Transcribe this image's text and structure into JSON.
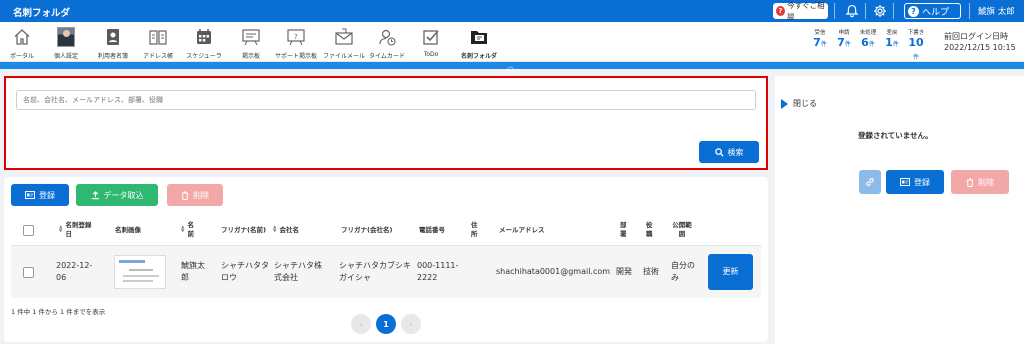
{
  "topbar": {
    "title": "名刺フォルダ",
    "consult_label": "今すぐご相談",
    "help_label": "ヘルプ",
    "user_name": "鯱旗 太郎"
  },
  "nav": {
    "items": [
      {
        "label": "ポータル",
        "icon": "home-icon"
      },
      {
        "label": "個人設定",
        "icon": "avatar"
      },
      {
        "label": "利用者名簿",
        "icon": "id-card-icon"
      },
      {
        "label": "アドレス帳",
        "icon": "address-book-icon"
      },
      {
        "label": "スケジューラ",
        "icon": "calendar-icon"
      },
      {
        "label": "掲示板",
        "icon": "board-icon"
      },
      {
        "label": "サポート掲示板",
        "icon": "support-board-icon"
      },
      {
        "label": "ファイルメール",
        "icon": "file-mail-icon"
      },
      {
        "label": "タイムカード",
        "icon": "timecard-icon"
      },
      {
        "label": "ToDo",
        "icon": "check-icon"
      },
      {
        "label": "名刺フォルダ",
        "icon": "card-folder-icon"
      }
    ]
  },
  "stats": [
    {
      "label": "受信",
      "value": "7",
      "unit": "件"
    },
    {
      "label": "申請",
      "value": "7",
      "unit": "件"
    },
    {
      "label": "未処理",
      "value": "6",
      "unit": "件"
    },
    {
      "label": "差戻",
      "value": "1",
      "unit": "件"
    },
    {
      "label": "下書き",
      "value": "10",
      "unit": "件"
    }
  ],
  "last_login": {
    "label": "前回ログイン日時",
    "value": "2022/12/15 10:15"
  },
  "search": {
    "placeholder": "名前、会社名、メールアドレス、部署、役職",
    "button_label": "検索"
  },
  "toolbar": {
    "register_label": "登録",
    "import_label": "データ取込",
    "delete_label": "削除"
  },
  "table": {
    "columns": {
      "reg_date": "名刺登録日",
      "image": "名刺画像",
      "name": "名前",
      "furigana_name": "フリガナ(名前)",
      "company": "会社名",
      "furigana_company": "フリガナ(会社名)",
      "phone": "電話番号",
      "address": "住所",
      "email": "メールアドレス",
      "dept": "部署",
      "title": "役職",
      "scope": "公開範囲"
    },
    "rows": [
      {
        "reg_date": "2022-12-06",
        "name": "鯱旗太郎",
        "furigana_name": "シャチハタタロウ",
        "company": "シャチハタ株式会社",
        "furigana_company": "シャチハタカブシキガイシャ",
        "phone": "000-1111-2222",
        "address": "",
        "email": "shachihata0001@gmail.com",
        "dept": "開発",
        "title": "技術",
        "scope": "自分のみ",
        "update_label": "更新"
      }
    ],
    "count_text": "1 件中 1 件から 1 件までを表示",
    "current_page": "1"
  },
  "right_panel": {
    "close_label": "閉じる",
    "empty_text": "登録されていません。",
    "register_label": "登録",
    "delete_label": "削除"
  },
  "colors": {
    "primary": "#0a6fd4",
    "success": "#2eb872",
    "danger_disabled": "#f3a8a8",
    "highlight_border": "#e00000"
  }
}
